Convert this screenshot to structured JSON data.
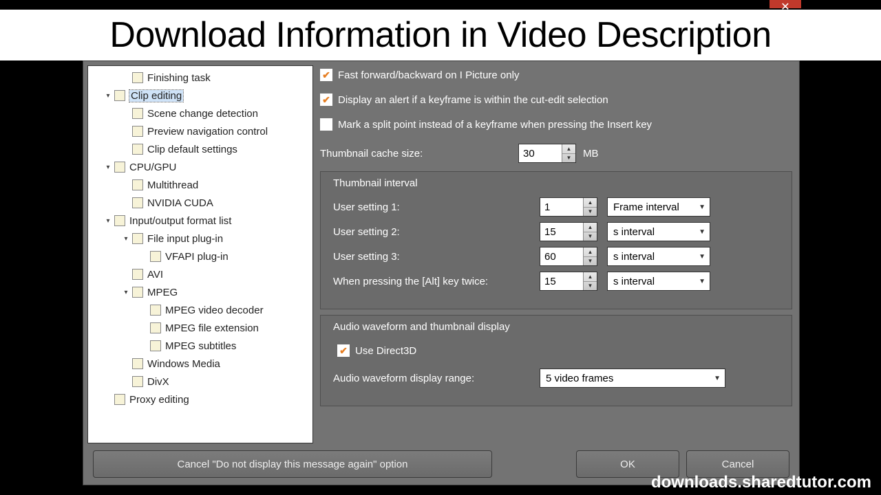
{
  "overlay": {
    "banner": "Download Information in Video Description",
    "watermark": "downloads.sharedtutor.com"
  },
  "tree": {
    "finishing_task": "Finishing task",
    "clip_editing": "Clip editing",
    "scene_change": "Scene change detection",
    "preview_nav": "Preview navigation control",
    "clip_defaults": "Clip default settings",
    "cpu_gpu": "CPU/GPU",
    "multithread": "Multithread",
    "cuda": "NVIDIA CUDA",
    "io_format": "Input/output format list",
    "file_input": "File input plug-in",
    "vfapi": "VFAPI plug-in",
    "avi": "AVI",
    "mpeg": "MPEG",
    "mpeg_decoder": "MPEG video decoder",
    "mpeg_ext": "MPEG file extension",
    "mpeg_subs": "MPEG subtitles",
    "wmv": "Windows Media",
    "divx": "DivX",
    "proxy": "Proxy editing"
  },
  "settings": {
    "chk_fastfwd": "Fast forward/backward on I Picture only",
    "chk_keyframe_alert": "Display an alert if a keyframe is within the cut-edit selection",
    "chk_split_point": "Mark a split point instead of a keyframe when pressing the Insert key",
    "cache_label": "Thumbnail cache size:",
    "cache_value": "30",
    "cache_unit": "MB",
    "thumb_interval_title": "Thumbnail interval",
    "u1_label": "User setting 1:",
    "u1_value": "1",
    "u1_unit": "Frame interval",
    "u2_label": "User setting 2:",
    "u2_value": "15",
    "u2_unit": "s interval",
    "u3_label": "User setting 3:",
    "u3_value": "60",
    "u3_unit": "s interval",
    "alt_label": "When pressing the [Alt] key twice:",
    "alt_value": "15",
    "alt_unit": "s interval",
    "audio_group_title": "Audio waveform and thumbnail display",
    "use_d3d": "Use Direct3D",
    "audio_range_label": "Audio waveform display range:",
    "audio_range_value": "5 video frames"
  },
  "buttons": {
    "cancel_msg": "Cancel \"Do not display this message again\" option",
    "ok": "OK",
    "cancel": "Cancel"
  }
}
